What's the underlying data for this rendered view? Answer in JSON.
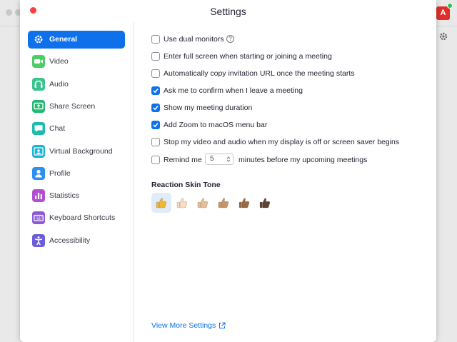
{
  "window": {
    "title": "Settings"
  },
  "background": {
    "avatar_letter": "A"
  },
  "sidebar": {
    "items": [
      {
        "label": "General",
        "icon": "gear-icon",
        "color": "#0e71eb",
        "active": true
      },
      {
        "label": "Video",
        "icon": "video-camera-icon",
        "color": "#4fcc66",
        "active": false
      },
      {
        "label": "Audio",
        "icon": "headphones-icon",
        "color": "#3bc48f",
        "active": false
      },
      {
        "label": "Share Screen",
        "icon": "share-screen-icon",
        "color": "#23b873",
        "active": false
      },
      {
        "label": "Chat",
        "icon": "chat-bubble-icon",
        "color": "#1fb9ad",
        "active": false
      },
      {
        "label": "Virtual Background",
        "icon": "person-background-icon",
        "color": "#19b3d6",
        "active": false
      },
      {
        "label": "Profile",
        "icon": "person-icon",
        "color": "#2d8ff0",
        "active": false
      },
      {
        "label": "Statistics",
        "icon": "bar-chart-icon",
        "color": "#b24fd0",
        "active": false
      },
      {
        "label": "Keyboard Shortcuts",
        "icon": "keyboard-icon",
        "color": "#8b59d6",
        "active": false
      },
      {
        "label": "Accessibility",
        "icon": "accessibility-icon",
        "color": "#6b5cd8",
        "active": false
      }
    ]
  },
  "general": {
    "options": [
      {
        "label": "Use dual monitors",
        "checked": false,
        "help": true
      },
      {
        "label": "Enter full screen when starting or joining a meeting",
        "checked": false
      },
      {
        "label": "Automatically copy invitation URL once the meeting starts",
        "checked": false
      },
      {
        "label": "Ask me to confirm when I leave a meeting",
        "checked": true
      },
      {
        "label": "Show my meeting duration",
        "checked": true
      },
      {
        "label": "Add Zoom to macOS menu bar",
        "checked": true
      },
      {
        "label": "Stop my video and audio when my display is off or screen saver begins",
        "checked": false
      }
    ],
    "reminder": {
      "label": "Remind me",
      "checked": false,
      "minutes_value": "5",
      "suffix": "minutes before my upcoming meetings"
    },
    "reaction_heading": "Reaction Skin Tone",
    "skin_tones": [
      {
        "name": "default-yellow",
        "color": "#f5b731",
        "selected": true
      },
      {
        "name": "light",
        "color": "#f7dcc1",
        "selected": false
      },
      {
        "name": "medium-light",
        "color": "#e8bd93",
        "selected": false
      },
      {
        "name": "medium",
        "color": "#c79569",
        "selected": false
      },
      {
        "name": "medium-dark",
        "color": "#9a6a44",
        "selected": false
      },
      {
        "name": "dark",
        "color": "#5e4232",
        "selected": false
      }
    ],
    "view_more": "View More Settings"
  },
  "colors": {
    "accent": "#0e71eb",
    "close": "#fd3f3a"
  }
}
